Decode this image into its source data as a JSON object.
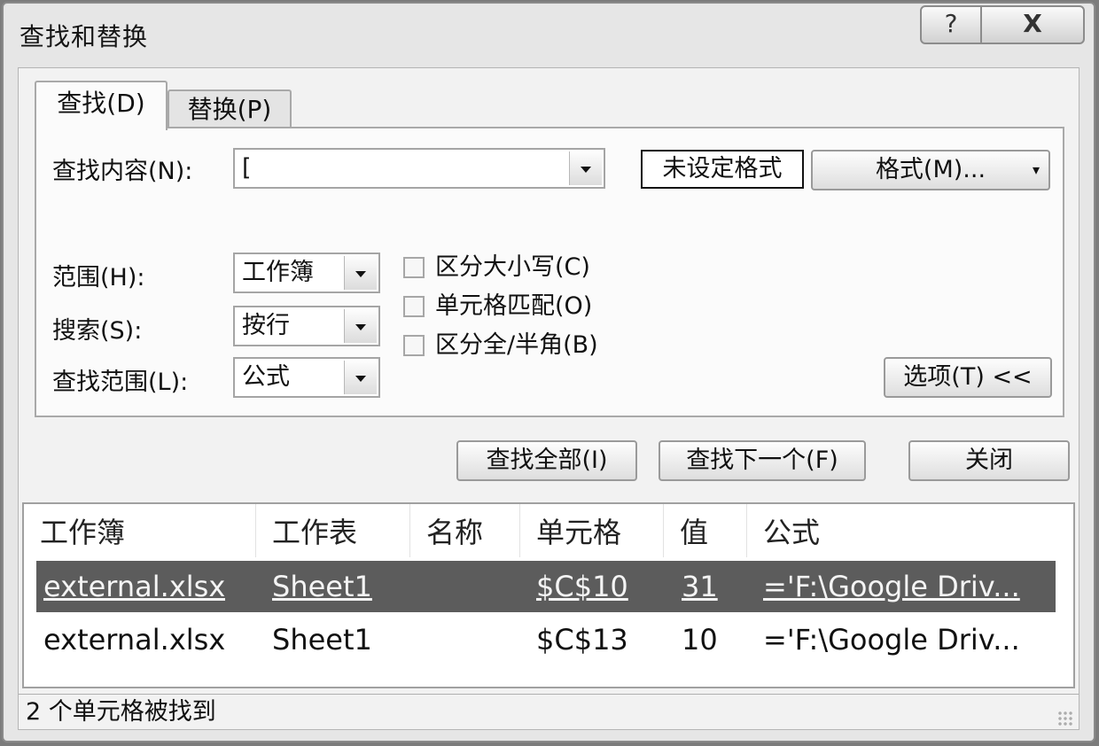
{
  "window": {
    "title": "查找和替换",
    "help_glyph": "?",
    "close_glyph": "X"
  },
  "tabs": [
    {
      "label": "查找(D)"
    },
    {
      "label": "替换(P)"
    }
  ],
  "find": {
    "label": "查找内容(N):",
    "value": "[",
    "format_status": "未设定格式",
    "format_button": "格式(M)...",
    "format_caret": "▾"
  },
  "options": {
    "scope": {
      "label": "范围(H):",
      "value": "工作簿"
    },
    "search": {
      "label": "搜索(S):",
      "value": "按行"
    },
    "look_in": {
      "label": "查找范围(L):",
      "value": "公式"
    },
    "match_case": {
      "label": "区分大小写(C)",
      "checked": false
    },
    "match_cell": {
      "label": "单元格匹配(O)",
      "checked": false
    },
    "match_width": {
      "label": "区分全/半角(B)",
      "checked": false
    },
    "options_button": "选项(T) <<"
  },
  "actions": {
    "find_all": "查找全部(I)",
    "find_next": "查找下一个(F)",
    "close": "关闭"
  },
  "results": {
    "columns": [
      "工作簿",
      "工作表",
      "名称",
      "单元格",
      "值",
      "公式"
    ],
    "rows": [
      {
        "workbook": "external.xlsx",
        "sheet": "Sheet1",
        "name": "",
        "cell": "$C$10",
        "value": "31",
        "formula": "='F:\\Google Driv...",
        "selected": true
      },
      {
        "workbook": "external.xlsx",
        "sheet": "Sheet1",
        "name": "",
        "cell": "$C$13",
        "value": "10",
        "formula": "='F:\\Google Driv...",
        "selected": false
      }
    ],
    "status": "2 个单元格被找到"
  }
}
